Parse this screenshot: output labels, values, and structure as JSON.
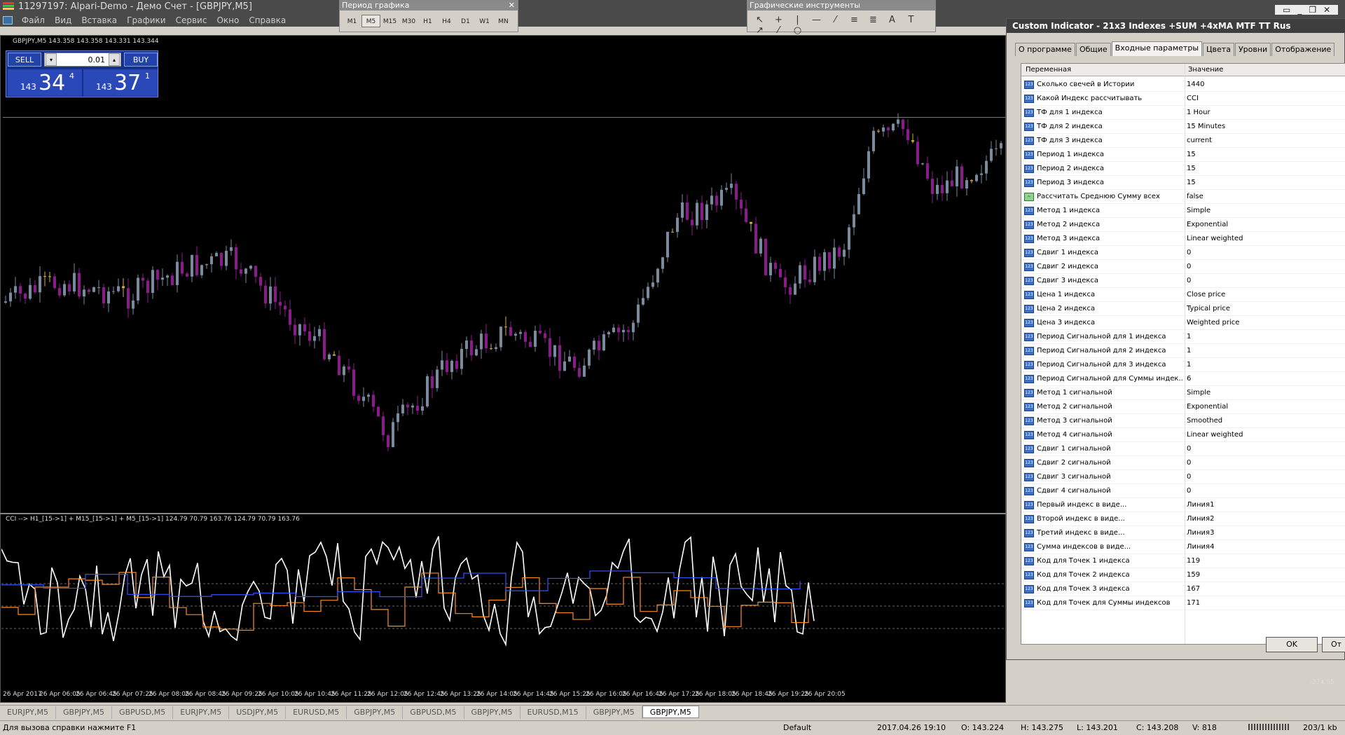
{
  "window": {
    "title": "11297197: Alpari-Demo - Демо Счет - [GBPJPY,M5]",
    "controls": [
      "▭",
      "_",
      "❐",
      "✕"
    ]
  },
  "menu": [
    "Файл",
    "Вид",
    "Вставка",
    "Графики",
    "Сервис",
    "Окно",
    "Справка"
  ],
  "period_toolbar": {
    "title": "Период графика",
    "periods": [
      "M1",
      "M5",
      "M15",
      "M30",
      "H1",
      "H4",
      "D1",
      "W1",
      "MN"
    ],
    "active": "M5"
  },
  "drawing_toolbar": {
    "title": "Графические инструменты",
    "tools": [
      "↖",
      "+",
      "|",
      "—",
      "⁄",
      "≡",
      "≣",
      "A",
      "T",
      "↗",
      "⁄",
      "○"
    ]
  },
  "chart": {
    "caption": "GBPJPY,M5  143.358 143.358 143.331 143.344",
    "colors": {
      "bull": "#7a8ba0",
      "bear": "#8b1a8b",
      "doji": "#d6b13a",
      "cci_white": "#ffffff",
      "cci_orange": "#ff8c1a",
      "cci_blue": "#3355ff"
    },
    "trade": {
      "sell_label": "SELL",
      "buy_label": "BUY",
      "lot": "0.01",
      "sell_prefix": "143",
      "sell_big": "34",
      "sell_sup": "4",
      "buy_prefix": "143",
      "buy_big": "37",
      "buy_sup": "1"
    },
    "indicator_caption": "CCI --> H1_[15->1] + M15_[15->1] + M5_[15->1] 124.79 70.79 163.76 124.79 70.79 163.76",
    "indicator_axis_label": "-274.05",
    "time_labels": [
      "26 Apr 2017",
      "26 Apr 06:05",
      "26 Apr 06:45",
      "26 Apr 07:25",
      "26 Apr 08:05",
      "26 Apr 08:45",
      "26 Apr 09:25",
      "26 Apr 10:05",
      "26 Apr 10:45",
      "26 Apr 11:25",
      "26 Apr 12:05",
      "26 Apr 12:45",
      "26 Apr 13:25",
      "26 Apr 14:05",
      "26 Apr 14:45",
      "26 Apr 15:25",
      "26 Apr 16:05",
      "26 Apr 16:45",
      "26 Apr 17:25",
      "26 Apr 18:05",
      "26 Apr 18:45",
      "26 Apr 19:25",
      "26 Apr 20:05"
    ]
  },
  "chart_tabs": [
    "EURJPY,M5",
    "GBPJPY,M5",
    "GBPUSD,M5",
    "EURJPY,M5",
    "USDJPY,M5",
    "EURUSD,M5",
    "GBPJPY,M5",
    "GBPUSD,M5",
    "GBPJPY,M5",
    "EURUSD,M15",
    "GBPJPY,M5",
    "GBPJPY,M5"
  ],
  "active_tab_index": 11,
  "statusbar": {
    "help": "Для вызова справки нажмите F1",
    "profile": "Default",
    "datetime": "2017.04.26 19:10",
    "open": "O: 143.224",
    "high": "H: 143.275",
    "low": "L: 143.201",
    "close": "C: 143.208",
    "volume": "V: 818",
    "traffic": "203/1 kb"
  },
  "dialog": {
    "title": "Custom Indicator - 21x3 Indexes +SUM +4xMA MTF TT Rus",
    "tabs": [
      "О программе",
      "Общие",
      "Входные параметры",
      "Цвета",
      "Уровни",
      "Отображение"
    ],
    "active_tab": 2,
    "col_variable": "Переменная",
    "col_value": "Значение",
    "params": [
      {
        "type": "123",
        "name": "Сколько свечей в Истории",
        "value": "1440"
      },
      {
        "type": "123",
        "name": "Какой Индекс рассчитывать",
        "value": "CCI"
      },
      {
        "type": "123",
        "name": "ТФ для 1 индекса",
        "value": "1 Hour"
      },
      {
        "type": "123",
        "name": "ТФ для 2 индекса",
        "value": "15 Minutes"
      },
      {
        "type": "123",
        "name": "ТФ для 3 индекса",
        "value": "current"
      },
      {
        "type": "123",
        "name": "Период 1 индекса",
        "value": "15"
      },
      {
        "type": "123",
        "name": "Период 2 индекса",
        "value": "15"
      },
      {
        "type": "123",
        "name": "Период 3 индекса",
        "value": "15"
      },
      {
        "type": "bool",
        "name": "Рассчитать Среднюю Сумму всех",
        "value": "false"
      },
      {
        "type": "123",
        "name": "Метод 1 индекса",
        "value": "Simple"
      },
      {
        "type": "123",
        "name": "Метод 2 индекса",
        "value": "Exponential"
      },
      {
        "type": "123",
        "name": "Метод 3 индекса",
        "value": "Linear weighted"
      },
      {
        "type": "123",
        "name": "Сдвиг 1 индекса",
        "value": "0"
      },
      {
        "type": "123",
        "name": "Сдвиг 2 индекса",
        "value": "0"
      },
      {
        "type": "123",
        "name": "Сдвиг 3 индекса",
        "value": "0"
      },
      {
        "type": "123",
        "name": "Цена 1 индекса",
        "value": "Close price"
      },
      {
        "type": "123",
        "name": "Цена 2 индекса",
        "value": "Typical price"
      },
      {
        "type": "123",
        "name": "Цена 3 индекса",
        "value": "Weighted price"
      },
      {
        "type": "123",
        "name": "Период Сигнальной для 1 индекса",
        "value": "1"
      },
      {
        "type": "123",
        "name": "Период Сигнальной для 2 индекса",
        "value": "1"
      },
      {
        "type": "123",
        "name": "Период Сигнальной для 3 индекса",
        "value": "1"
      },
      {
        "type": "123",
        "name": "Период Сигнальной для Суммы индек...",
        "value": "6"
      },
      {
        "type": "123",
        "name": "Метод 1 сигнальной",
        "value": "Simple"
      },
      {
        "type": "123",
        "name": "Метод 2 сигнальной",
        "value": "Exponential"
      },
      {
        "type": "123",
        "name": "Метод 3 сигнальной",
        "value": "Smoothed"
      },
      {
        "type": "123",
        "name": "Метод 4 сигнальной",
        "value": "Linear weighted"
      },
      {
        "type": "123",
        "name": "Сдвиг 1 сигнальной",
        "value": "0"
      },
      {
        "type": "123",
        "name": "Сдвиг 2 сигнальной",
        "value": "0"
      },
      {
        "type": "123",
        "name": "Сдвиг 3 сигнальной",
        "value": "0"
      },
      {
        "type": "123",
        "name": "Сдвиг 4 сигнальной",
        "value": "0"
      },
      {
        "type": "123",
        "name": "Первый индекс в виде...",
        "value": "Линия1"
      },
      {
        "type": "123",
        "name": "Второй индекс в виде...",
        "value": "Линия2"
      },
      {
        "type": "123",
        "name": "Третий индекс в виде...",
        "value": "Линия3"
      },
      {
        "type": "123",
        "name": "Сумма индексов в виде...",
        "value": "Линия4"
      },
      {
        "type": "123",
        "name": "Код для Точек 1 индекса",
        "value": "119"
      },
      {
        "type": "123",
        "name": "Код для Точек 2 индекса",
        "value": "159"
      },
      {
        "type": "123",
        "name": "Код для Точек 3 индекса",
        "value": "167"
      },
      {
        "type": "123",
        "name": "Код для Точек для Суммы индексов",
        "value": "171"
      }
    ],
    "ok_label": "OK",
    "cancel_label": "От"
  }
}
